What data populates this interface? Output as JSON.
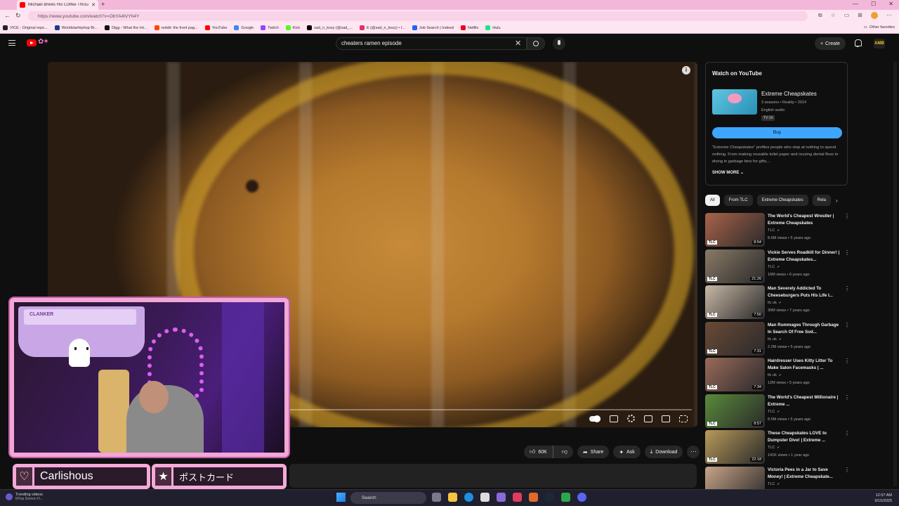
{
  "browser": {
    "tab_title": "Michael Brews His Coffee Throu...",
    "new_tab": "+",
    "url": "https://www.youtube.com/watch?v=ObYA4tVYh4Y",
    "bookmarks": [
      {
        "label": "VICE - Original repo...",
        "color": "#222222"
      },
      {
        "label": "Worldstarhiphop Br...",
        "color": "#1e3a8a"
      },
      {
        "label": "Digg - What the Int...",
        "color": "#111111"
      },
      {
        "label": "reddit: the front pag...",
        "color": "#ff4500"
      },
      {
        "label": "YouTube",
        "color": "#ff0000"
      },
      {
        "label": "Google",
        "color": "#4285f4"
      },
      {
        "label": "Twitch",
        "color": "#9146ff"
      },
      {
        "label": "Kick",
        "color": "#53fc18"
      },
      {
        "label": "sad_n_kozy (@sad_...",
        "color": "#000000"
      },
      {
        "label": "E (@sad_n_kozy) • I...",
        "color": "#e1306c"
      },
      {
        "label": "Job Search | Indeed",
        "color": "#2164f3"
      },
      {
        "label": "Netflix",
        "color": "#e50914"
      },
      {
        "label": "Hulu",
        "color": "#1ce783"
      }
    ],
    "other_favorites": "Other favorites"
  },
  "youtube": {
    "search_query": "cheaters ramen episode",
    "create_label": "Create",
    "avatar_text": "AMB"
  },
  "video_actions": {
    "likes": "60K",
    "share": "Share",
    "ask": "Ask",
    "download": "Download",
    "more": "···"
  },
  "watch_card": {
    "heading": "Watch on YouTube",
    "show_name": "Extreme Cheapskates",
    "meta": "3 seasons • Reality • 2014",
    "audio": "English audio",
    "rating": "TV-14",
    "buy_label": "Buy",
    "description": "\"Extreme Cheapskates\" profiles people who stop at nothing to spend nothing. From making reusable toilet paper and reusing dental floss to diving in garbage bins for gifts,...",
    "show_more": "SHOW MORE"
  },
  "chips": [
    "All",
    "From TLC",
    "Extreme Cheapskates",
    "Rela"
  ],
  "recommendations": [
    {
      "title": "The World's Cheapest Wrestler | Extreme Cheapskates",
      "channel": "TLC",
      "meta": "8.6M views • 5 years ago",
      "duration": "8:54",
      "thumb_color": "#a9634a"
    },
    {
      "title": "Vickie Serves Roadkill for Dinner! | Extreme Cheapskates...",
      "channel": "TLC",
      "meta": "10M views • 6 years ago",
      "duration": "21:26",
      "thumb_color": "#8a7a66"
    },
    {
      "title": "Man Severely Addicted To Cheeseburgers Puts His Life I...",
      "channel": "tlc uk",
      "meta": "30M views • 7 years ago",
      "duration": "7:50",
      "thumb_color": "#c9b8a6"
    },
    {
      "title": "Man Rummages Through Garbage In Search Of Free Sod...",
      "channel": "tlc uk",
      "meta": "2.2M views • 5 years ago",
      "duration": "7:31",
      "thumb_color": "#6b4a36"
    },
    {
      "title": "Hairdresser Uses Kitty Litter To Make Salon Facemasks | ...",
      "channel": "tlc uk",
      "meta": "12M views • 5 years ago",
      "duration": "7:34",
      "thumb_color": "#9a6a5a"
    },
    {
      "title": "The World's Cheapest Millionaire | Extreme ...",
      "channel": "TLC",
      "meta": "8.5M views • 5 years ago",
      "duration": "8:57",
      "thumb_color": "#5a8a3a"
    },
    {
      "title": "These Cheapskates LOVE to Dumpster Dive! | Extreme ...",
      "channel": "TLC",
      "meta": "141K views • 1 year ago",
      "duration": "22:18",
      "thumb_color": "#b89a5a"
    },
    {
      "title": "Victoria Pees in a Jar to Save Money! | Extreme Cheapskate...",
      "channel": "TLC",
      "meta": "",
      "duration": "",
      "thumb_color": "#c8a488"
    }
  ],
  "overlay": {
    "slime_label": "CLANKER",
    "name_box": "Carlishous",
    "postcard_box": "ポストカード"
  },
  "taskbar": {
    "news_title": "Trending videos",
    "news_sub": "KPop Demon H...",
    "search_label": "Search",
    "time": "12:07 AM",
    "date": "9/15/2025"
  }
}
